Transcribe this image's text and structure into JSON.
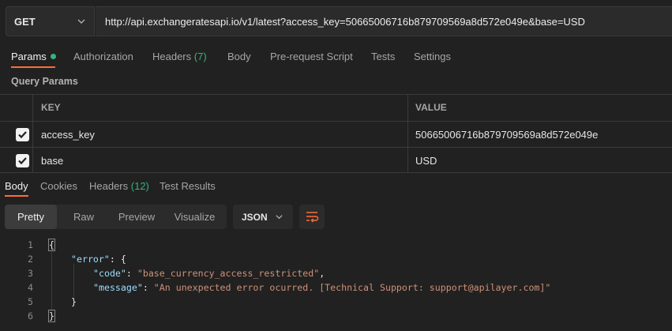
{
  "request": {
    "method": "GET",
    "url": "http://api.exchangeratesapi.io/v1/latest?access_key=50665006716b879709569a8d572e049e&base=USD"
  },
  "request_tabs": {
    "params": "Params",
    "authorization": "Authorization",
    "headers": "Headers",
    "headers_count": "(7)",
    "body": "Body",
    "pre_request": "Pre-request Script",
    "tests": "Tests",
    "settings": "Settings"
  },
  "query_params": {
    "title": "Query Params",
    "columns": [
      "KEY",
      "VALUE"
    ],
    "rows": [
      {
        "key": "access_key",
        "value": "50665006716b879709569a8d572e049e",
        "checked": true
      },
      {
        "key": "base",
        "value": "USD",
        "checked": true
      }
    ]
  },
  "response_tabs": {
    "body": "Body",
    "cookies": "Cookies",
    "headers": "Headers",
    "headers_count": "(12)",
    "test_results": "Test Results"
  },
  "view_modes": [
    "Pretty",
    "Raw",
    "Preview",
    "Visualize"
  ],
  "format": "JSON",
  "code": {
    "line_numbers": [
      "1",
      "2",
      "3",
      "4",
      "5",
      "6"
    ],
    "open_brace": "{",
    "error_key": "\"error\"",
    "code_key": "\"code\"",
    "code_value": "\"base_currency_access_restricted\"",
    "message_key": "\"message\"",
    "message_value": "\"An unexpected error ocurred. [Technical Support: support@apilayer.com]\"",
    "inner_close": "}",
    "close_brace": "}"
  },
  "colors": {
    "accent": "#ff6c37",
    "green": "#36b37e",
    "json_key": "#9cdcfe",
    "json_string": "#ce9178"
  }
}
